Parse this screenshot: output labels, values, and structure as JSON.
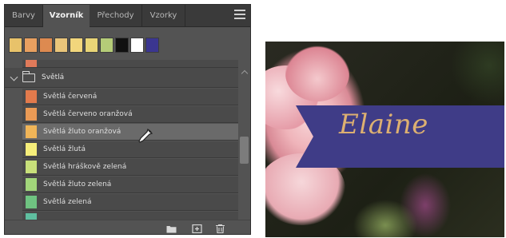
{
  "panel": {
    "tabs": [
      {
        "label": "Barvy"
      },
      {
        "label": "Vzorník"
      },
      {
        "label": "Přechody"
      },
      {
        "label": "Vzorky"
      }
    ],
    "active_tab": "Vzorník",
    "recent_swatches": [
      "#e8c26a",
      "#e8a060",
      "#dd8a50",
      "#eac57a",
      "#f2d67c",
      "#e9d577",
      "#b5cc78",
      "#111111",
      "#ffffff",
      "#3b3690"
    ],
    "partial_row_color": "#e07a5a",
    "group": {
      "label": "Světlá",
      "expanded": true
    },
    "swatches": [
      {
        "label": "Světlá červená",
        "color": "#e27a4c"
      },
      {
        "label": "Světlá červeno oranžová",
        "color": "#ea9a55"
      },
      {
        "label": "Světlá žluto oranžová",
        "color": "#f0b558",
        "selected": true
      },
      {
        "label": "Světlá žlutá",
        "color": "#f6ee7a"
      },
      {
        "label": "Světlá hráškově zelená",
        "color": "#c8e07a"
      },
      {
        "label": "Světlá žluto zelená",
        "color": "#a2d67a"
      },
      {
        "label": "Světlá zelená",
        "color": "#6fc381"
      }
    ],
    "last_partial_color": "#5fbfa0",
    "bottom_icons": [
      "folder-icon",
      "new-swatch-icon",
      "trash-icon"
    ]
  },
  "photo": {
    "banner_text": "Elaine",
    "banner_color": "#3f3c87",
    "text_color": "#ddb071"
  }
}
